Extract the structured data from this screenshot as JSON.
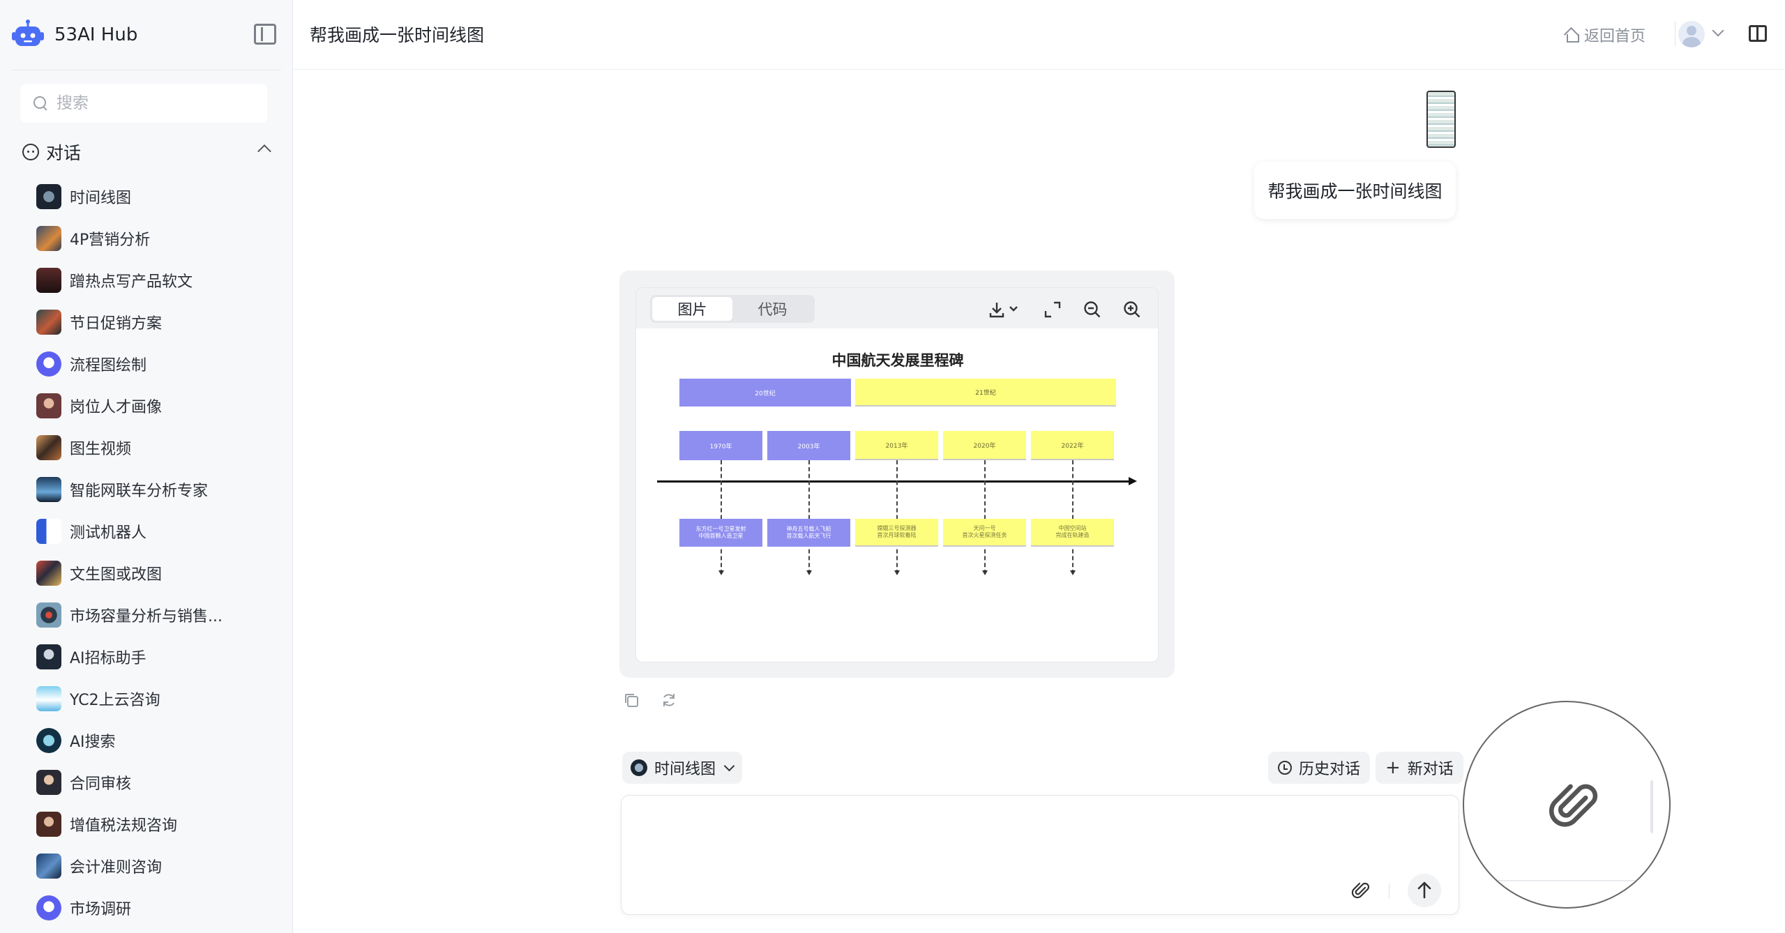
{
  "app": {
    "name": "53AI Hub",
    "accent": "#4b6ef5"
  },
  "sidebar": {
    "search_placeholder": "搜索",
    "section_title": "对话",
    "items": [
      {
        "label": "时间线图",
        "icon": "timeline-avatar"
      },
      {
        "label": "4P营销分析",
        "icon": "marketing-avatar"
      },
      {
        "label": "蹭热点写产品软文",
        "icon": "microphone-avatar"
      },
      {
        "label": "节日促销方案",
        "icon": "festival-avatar"
      },
      {
        "label": "流程图绘制",
        "icon": "robot-avatar"
      },
      {
        "label": "岗位人才画像",
        "icon": "person-avatar"
      },
      {
        "label": "图生视频",
        "icon": "video-avatar"
      },
      {
        "label": "智能网联车分析专家",
        "icon": "car-avatar"
      },
      {
        "label": "测试机器人",
        "icon": "bot-avatar"
      },
      {
        "label": "文生图或改图",
        "icon": "image-avatar"
      },
      {
        "label": "市场容量分析与销售...",
        "icon": "target-avatar"
      },
      {
        "label": "AI招标助手",
        "icon": "bid-avatar"
      },
      {
        "label": "YC2上云咨询",
        "icon": "cloud-avatar"
      },
      {
        "label": "AI搜索",
        "icon": "search-avatar"
      },
      {
        "label": "合同审核",
        "icon": "contract-avatar"
      },
      {
        "label": "增值税法规咨询",
        "icon": "tax-avatar"
      },
      {
        "label": "会计准则咨询",
        "icon": "accounting-avatar"
      },
      {
        "label": "市场调研",
        "icon": "research-avatar"
      }
    ]
  },
  "header": {
    "title": "帮我画成一张时间线图",
    "home_label": "返回首页"
  },
  "conversation": {
    "user_message": "帮我画成一张时间线图",
    "preview": {
      "tabs": [
        "图片",
        "代码"
      ],
      "active_tab": 0,
      "timeline": {
        "title": "中国航天发展里程碑",
        "eras": [
          "20世纪",
          "21世纪"
        ],
        "years": [
          "1970年",
          "2003年",
          "2013年",
          "2020年",
          "2022年"
        ],
        "events": [
          "东方红一号卫星发射\n中国首颗人造卫星",
          "神舟五号载人飞船\n首次载人航天飞行",
          "嫦娥三号探测器\n首次月球软着陆",
          "天问一号\n首次火星探测任务",
          "中国空间站\n完成在轨建造"
        ],
        "colors": {
          "blue": "#8e8ef0",
          "yellow": "#fdfd7e"
        }
      }
    }
  },
  "composer": {
    "assistant_name": "时间线图",
    "history_label": "历史对话",
    "new_chat_label": "新对话",
    "placeholder": ""
  }
}
